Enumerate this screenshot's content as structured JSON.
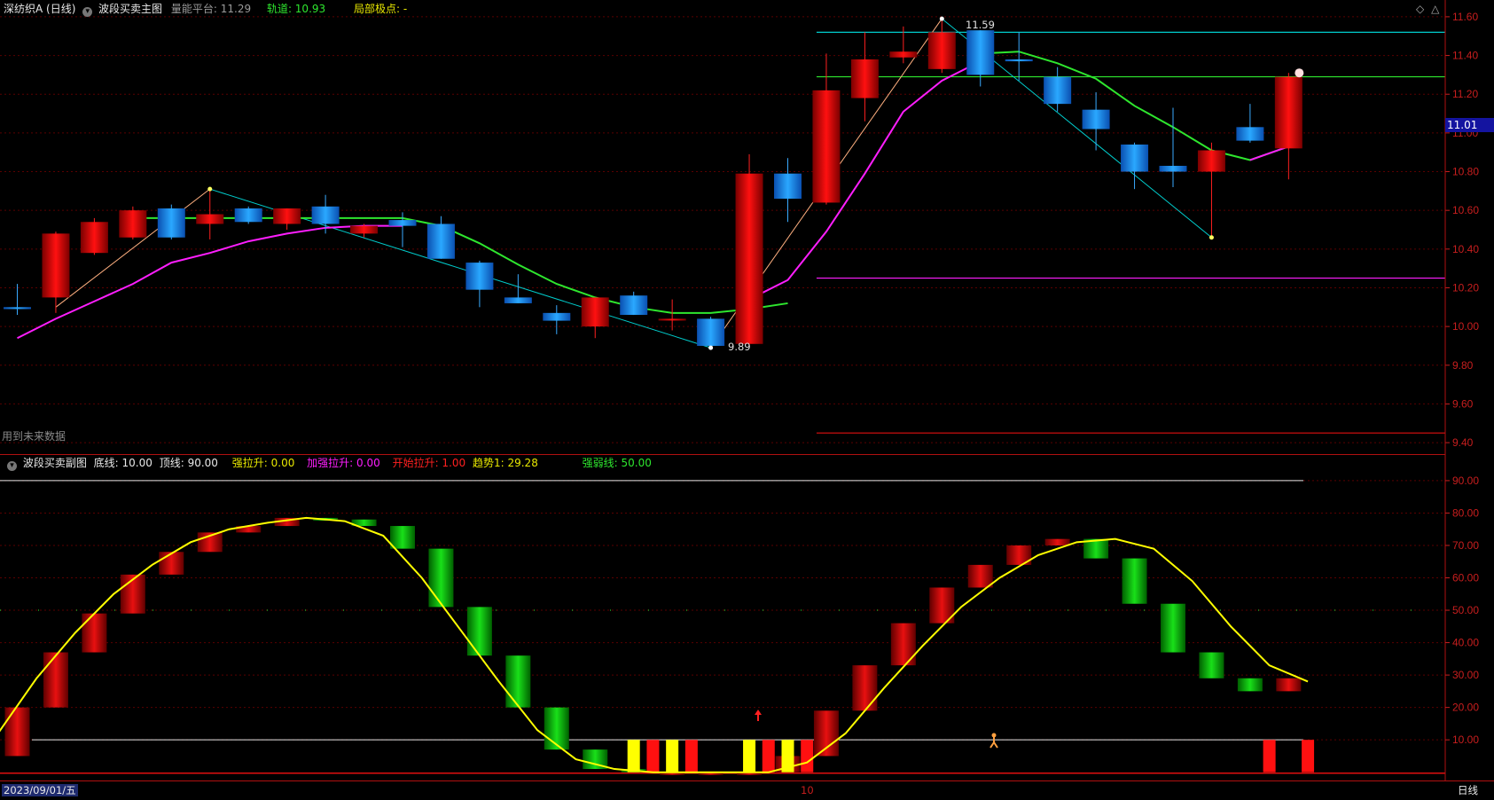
{
  "colors": {
    "up": "#e00000",
    "down": "#1e8fff",
    "ma": "#2ee62e",
    "trend": "#ff1eff",
    "grid": "#5a0000",
    "axis_text": "#c81e1e",
    "yellow": "#ffff00",
    "cyan": "#00cccc",
    "price_badge": "#1414a0"
  },
  "main_header": {
    "stock_title": "深纺织A (日线)",
    "indicator_name": "波段买卖主图",
    "platform_label": "量能平台: 11.29",
    "track_label": "轨道: 10.93",
    "local_pivot_label": "局部极点: -"
  },
  "sub_header": {
    "indicator_name": "波段买卖副图",
    "bottom_line_label": "底线: 10.00",
    "top_line_label": "顶线: 90.00",
    "strong_pull_label": "强拉升: 0.00",
    "extra_pull_label": "加强拉升: 0.00",
    "start_pull_label": "开始拉升: 1.00",
    "trend_label": "趋势1: 29.28",
    "strength_line_label": "强弱线: 50.00"
  },
  "future_data_note": "用到未来数据",
  "current_price_badge": "11.01",
  "annotations": {
    "high_label": "11.59",
    "low_label": "9.89"
  },
  "bottom_bar": {
    "date_label": "2023/09/01/五",
    "month_marker": "10",
    "period_label": "日线"
  },
  "chart_data": [
    {
      "type": "candlestick",
      "ylim": [
        9.35,
        11.65
      ],
      "y_ticks": [
        "11.60",
        "11.40",
        "11.20",
        "11.00",
        "10.80",
        "10.60",
        "10.40",
        "10.20",
        "10.00",
        "9.80",
        "9.60",
        "9.40"
      ],
      "grid": true,
      "candles": [
        {
          "o": 10.1,
          "h": 10.22,
          "l": 10.06,
          "c": 10.09
        },
        {
          "o": 10.15,
          "h": 10.49,
          "l": 10.07,
          "c": 10.48
        },
        {
          "o": 10.38,
          "h": 10.56,
          "l": 10.37,
          "c": 10.54
        },
        {
          "o": 10.46,
          "h": 10.62,
          "l": 10.45,
          "c": 10.6
        },
        {
          "o": 10.61,
          "h": 10.63,
          "l": 10.45,
          "c": 10.46
        },
        {
          "o": 10.53,
          "h": 10.71,
          "l": 10.45,
          "c": 10.58
        },
        {
          "o": 10.61,
          "h": 10.62,
          "l": 10.53,
          "c": 10.54
        },
        {
          "o": 10.53,
          "h": 10.61,
          "l": 10.5,
          "c": 10.61
        },
        {
          "o": 10.62,
          "h": 10.68,
          "l": 10.48,
          "c": 10.53
        },
        {
          "o": 10.48,
          "h": 10.53,
          "l": 10.46,
          "c": 10.52
        },
        {
          "o": 10.55,
          "h": 10.59,
          "l": 10.41,
          "c": 10.52
        },
        {
          "o": 10.53,
          "h": 10.57,
          "l": 10.35,
          "c": 10.35
        },
        {
          "o": 10.33,
          "h": 10.34,
          "l": 10.1,
          "c": 10.19
        },
        {
          "o": 10.15,
          "h": 10.27,
          "l": 10.13,
          "c": 10.12
        },
        {
          "o": 10.07,
          "h": 10.11,
          "l": 9.96,
          "c": 10.03
        },
        {
          "o": 10.0,
          "h": 10.15,
          "l": 9.94,
          "c": 10.15
        },
        {
          "o": 10.16,
          "h": 10.18,
          "l": 10.06,
          "c": 10.06
        },
        {
          "o": 10.04,
          "h": 10.14,
          "l": 9.98,
          "c": 10.04
        },
        {
          "o": 10.04,
          "h": 10.05,
          "l": 9.89,
          "c": 9.9
        },
        {
          "o": 9.91,
          "h": 10.89,
          "l": 9.89,
          "c": 10.79
        },
        {
          "o": 10.79,
          "h": 10.87,
          "l": 10.54,
          "c": 10.66
        },
        {
          "o": 10.64,
          "h": 11.41,
          "l": 10.63,
          "c": 11.22
        },
        {
          "o": 11.18,
          "h": 11.52,
          "l": 11.06,
          "c": 11.38
        },
        {
          "o": 11.39,
          "h": 11.55,
          "l": 11.36,
          "c": 11.42
        },
        {
          "o": 11.33,
          "h": 11.59,
          "l": 11.31,
          "c": 11.52
        },
        {
          "o": 11.53,
          "h": 11.53,
          "l": 11.24,
          "c": 11.3
        },
        {
          "o": 11.38,
          "h": 11.52,
          "l": 11.27,
          "c": 11.37
        },
        {
          "o": 11.29,
          "h": 11.34,
          "l": 11.11,
          "c": 11.15
        },
        {
          "o": 11.12,
          "h": 11.21,
          "l": 10.91,
          "c": 11.02
        },
        {
          "o": 10.94,
          "h": 10.95,
          "l": 10.71,
          "c": 10.8
        },
        {
          "o": 10.83,
          "h": 11.13,
          "l": 10.72,
          "c": 10.8
        },
        {
          "o": 10.8,
          "h": 10.95,
          "l": 10.46,
          "c": 10.91
        },
        {
          "o": 11.03,
          "h": 11.15,
          "l": 10.95,
          "c": 10.96
        },
        {
          "o": 10.92,
          "h": 11.31,
          "l": 10.76,
          "c": 11.29
        }
      ],
      "series": [
        {
          "values": [
            null,
            null,
            null,
            10.56,
            10.56,
            10.56,
            10.56,
            10.56,
            10.56,
            10.56,
            10.56,
            10.52,
            10.43,
            10.32,
            10.22,
            10.15,
            10.1,
            10.07,
            10.07,
            10.09,
            10.12,
            null,
            null,
            null,
            null,
            11.41,
            11.42,
            11.36,
            11.28,
            11.14,
            11.03,
            10.91,
            10.86,
            10.93
          ]
        },
        {
          "values": [
            9.94,
            10.04,
            10.13,
            10.22,
            10.33,
            10.38,
            10.44,
            10.48,
            10.51,
            10.52,
            10.52,
            null,
            null,
            null,
            null,
            null,
            null,
            null,
            null,
            10.14,
            10.24,
            10.49,
            10.79,
            11.11,
            11.27,
            11.37,
            null,
            null,
            null,
            null,
            null,
            null,
            10.86,
            10.93
          ]
        }
      ],
      "reference_lines": [
        {
          "y": 11.52,
          "from": 21
        },
        {
          "y": 11.29,
          "from": 21
        },
        {
          "y": 10.25,
          "from": 21
        },
        {
          "y": 9.45,
          "from": 21
        }
      ]
    },
    {
      "type": "bar",
      "ylim": [
        -2,
        96
      ],
      "y_ticks": [
        "90.00",
        "80.00",
        "70.00",
        "60.00",
        "50.00",
        "40.00",
        "30.00",
        "20.00",
        "10.00"
      ],
      "grid": true,
      "bars": [
        {
          "from": 5,
          "to": 20
        },
        {
          "from": 20,
          "to": 37
        },
        {
          "from": 37,
          "to": 49
        },
        {
          "from": 49,
          "to": 61
        },
        {
          "from": 61,
          "to": 68
        },
        {
          "from": 68,
          "to": 74
        },
        {
          "from": 74,
          "to": 76
        },
        {
          "from": 76,
          "to": 78.5
        },
        {
          "from": 78.5,
          "to": 78
        },
        {
          "from": 78,
          "to": 76
        },
        {
          "from": 76,
          "to": 69
        },
        {
          "from": 69,
          "to": 51
        },
        {
          "from": 51,
          "to": 36
        },
        {
          "from": 36,
          "to": 20
        },
        {
          "from": 20,
          "to": 7
        },
        {
          "from": 7,
          "to": 1
        },
        {
          "from": 1,
          "to": 0
        },
        {
          "from": 0,
          "to": 0
        },
        {
          "from": 0,
          "to": 0
        },
        {
          "from": 0,
          "to": 0
        },
        {
          "from": 0,
          "to": 5
        },
        {
          "from": 5,
          "to": 19
        },
        {
          "from": 19,
          "to": 33
        },
        {
          "from": 33,
          "to": 46
        },
        {
          "from": 46,
          "to": 57
        },
        {
          "from": 57,
          "to": 64
        },
        {
          "from": 64,
          "to": 70
        },
        {
          "from": 70,
          "to": 72
        },
        {
          "from": 72,
          "to": 66
        },
        {
          "from": 66,
          "to": 52
        },
        {
          "from": 52,
          "to": 37
        },
        {
          "from": 37,
          "to": 29
        },
        {
          "from": 29,
          "to": 25
        },
        {
          "from": 25,
          "to": 29
        }
      ],
      "line": [
        12,
        29,
        43,
        55,
        64,
        71,
        75,
        77,
        78.5,
        77.5,
        73,
        60,
        44,
        28,
        13,
        4,
        1,
        0,
        0,
        0,
        0,
        3,
        12,
        26,
        39,
        51,
        60,
        67,
        71,
        72,
        69,
        59,
        45,
        33,
        28
      ],
      "signal_bars": [
        {
          "i": 16,
          "color": "yellow"
        },
        {
          "i": 16.5,
          "color": "red"
        },
        {
          "i": 17,
          "color": "yellow"
        },
        {
          "i": 17.5,
          "color": "red"
        },
        {
          "i": 19,
          "color": "yellow"
        },
        {
          "i": 19.5,
          "color": "red"
        },
        {
          "i": 20,
          "color": "yellow"
        },
        {
          "i": 20.5,
          "color": "red"
        },
        {
          "i": 32.5,
          "color": "red"
        },
        {
          "i": 33.5,
          "color": "red"
        }
      ],
      "reference_lines": [
        {
          "y": 90,
          "color": "white"
        },
        {
          "y": 10,
          "color": "white"
        },
        {
          "y": 50,
          "color": "green_dotted"
        },
        {
          "y": 0,
          "color": "red"
        }
      ]
    }
  ]
}
